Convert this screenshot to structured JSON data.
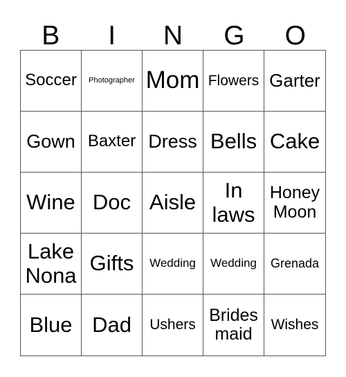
{
  "header": [
    "B",
    "I",
    "N",
    "G",
    "O"
  ],
  "cells": [
    [
      "Soccer",
      "Photographer",
      "Mom",
      "Flowers",
      "Garter"
    ],
    [
      "Gown",
      "Baxter",
      "Dress",
      "Bells",
      "Cake"
    ],
    [
      "Wine",
      "Doc",
      "Aisle",
      "In laws",
      "Honey Moon"
    ],
    [
      "Lake Nona",
      "Gifts",
      "Wedding",
      "Wedding",
      "Grenada"
    ],
    [
      "Blue",
      "Dad",
      "Ushers",
      "Brides maid",
      "Wishes"
    ]
  ]
}
